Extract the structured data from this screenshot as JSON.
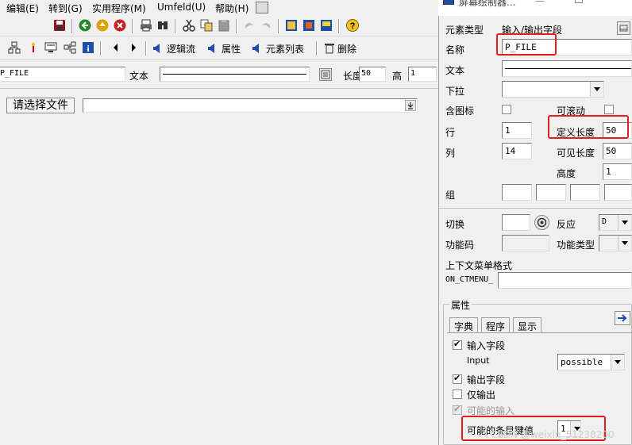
{
  "menu": [
    "编辑(E)",
    "转到(G)",
    "实用程序(M)",
    "Umfeld(U)",
    "帮助(H)"
  ],
  "toolbar2": {
    "logic_flow": "逻辑流",
    "properties": "属性",
    "element_list": "元素列表",
    "delete": "删除"
  },
  "field_row": {
    "name_value": "P_FILE",
    "text_label": "文本",
    "length_label": "长度",
    "length_value": "50",
    "height_label": "高",
    "height_value": "1"
  },
  "canvas": {
    "choose_button": "请选择文件"
  },
  "panel": {
    "title": "屏幕绘制器...",
    "element_type_label": "元素类型",
    "element_type_value": "输入/输出字段",
    "name_label": "名称",
    "name_value": "P_FILE",
    "text_label": "文本",
    "dropdown_label": "下拉",
    "with_icon_label": "含图标",
    "scrollable_label": "可滚动",
    "row_label": "行",
    "row_value": "1",
    "def_length_label": "定义长度",
    "def_length_value": "50",
    "col_label": "列",
    "col_value": "14",
    "vis_length_label": "可见长度",
    "vis_length_value": "50",
    "height_label": "高度",
    "height_value": "1",
    "group_label": "组",
    "switch_label": "切换",
    "response_label": "反应",
    "response_value": "D",
    "func_code_label": "功能码",
    "func_type_label": "功能类型",
    "ctx_menu_label": "上下文菜单格式",
    "ctx_menu_prefix": "ON_CTMENU_",
    "attributes_title": "属性",
    "tabs": [
      "字典",
      "程序",
      "显示"
    ],
    "input_field_label": "输入字段",
    "input_label": "Input",
    "input_value": "possible",
    "output_field_label": "输出字段",
    "output_only_label": "仅输出",
    "possible_input_label": "可能的输入",
    "possible_entries_label": "可能的条目键值",
    "possible_entries_value": "1",
    "watermark": "CSDN @weixin_51238200"
  },
  "colors": {
    "highlight": "#e02020",
    "arrow_blue": "#1f4ea8"
  }
}
